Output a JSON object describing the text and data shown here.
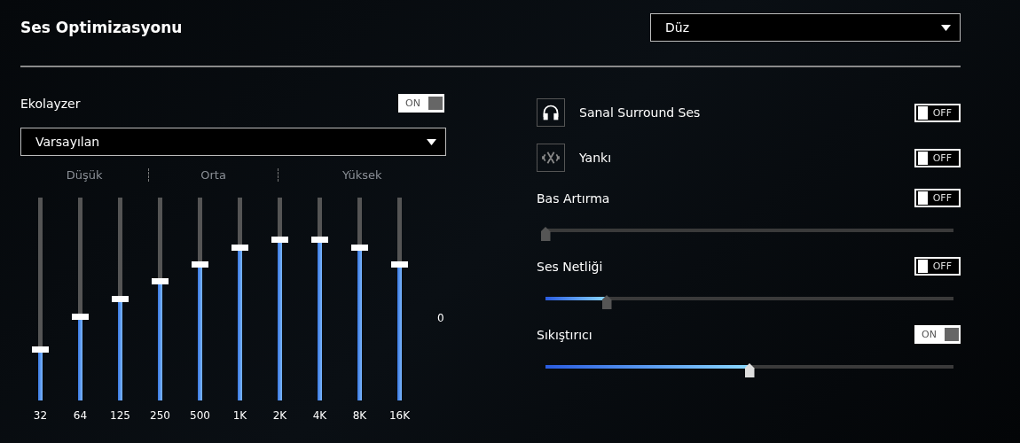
{
  "title": "Ses Optimizasyonu",
  "preset_dropdown": {
    "value": "Düz"
  },
  "equalizer": {
    "label": "Ekolayzer",
    "toggle": {
      "on": true,
      "label": "ON"
    },
    "preset": {
      "value": "Varsayılan"
    },
    "groups": [
      "Düşük",
      "Orta",
      "Yüksek"
    ],
    "bands": [
      {
        "label": "32",
        "level": 0.25
      },
      {
        "label": "64",
        "level": 0.41
      },
      {
        "label": "125",
        "level": 0.5
      },
      {
        "label": "250",
        "level": 0.585
      },
      {
        "label": "500",
        "level": 0.67
      },
      {
        "label": "1K",
        "level": 0.75
      },
      {
        "label": "2K",
        "level": 0.79
      },
      {
        "label": "4K",
        "level": 0.79
      },
      {
        "label": "8K",
        "level": 0.75
      },
      {
        "label": "16K",
        "level": 0.67
      }
    ],
    "zero_label": "0"
  },
  "effects": [
    {
      "kind": "icon",
      "label": "Sanal Surround Ses",
      "toggle": {
        "on": false,
        "label": "OFF"
      }
    },
    {
      "kind": "icon",
      "label": "Yankı",
      "toggle": {
        "on": false,
        "label": "OFF"
      }
    },
    {
      "kind": "slider",
      "label": "Bas Artırma",
      "toggle": {
        "on": false,
        "label": "OFF"
      },
      "level": 0
    },
    {
      "kind": "slider",
      "label": "Ses Netliği",
      "toggle": {
        "on": false,
        "label": "OFF"
      },
      "level": 0.15
    },
    {
      "kind": "slider",
      "label": "Sıkıştırıcı",
      "toggle": {
        "on": true,
        "label": "ON"
      },
      "level": 0.5
    }
  ]
}
